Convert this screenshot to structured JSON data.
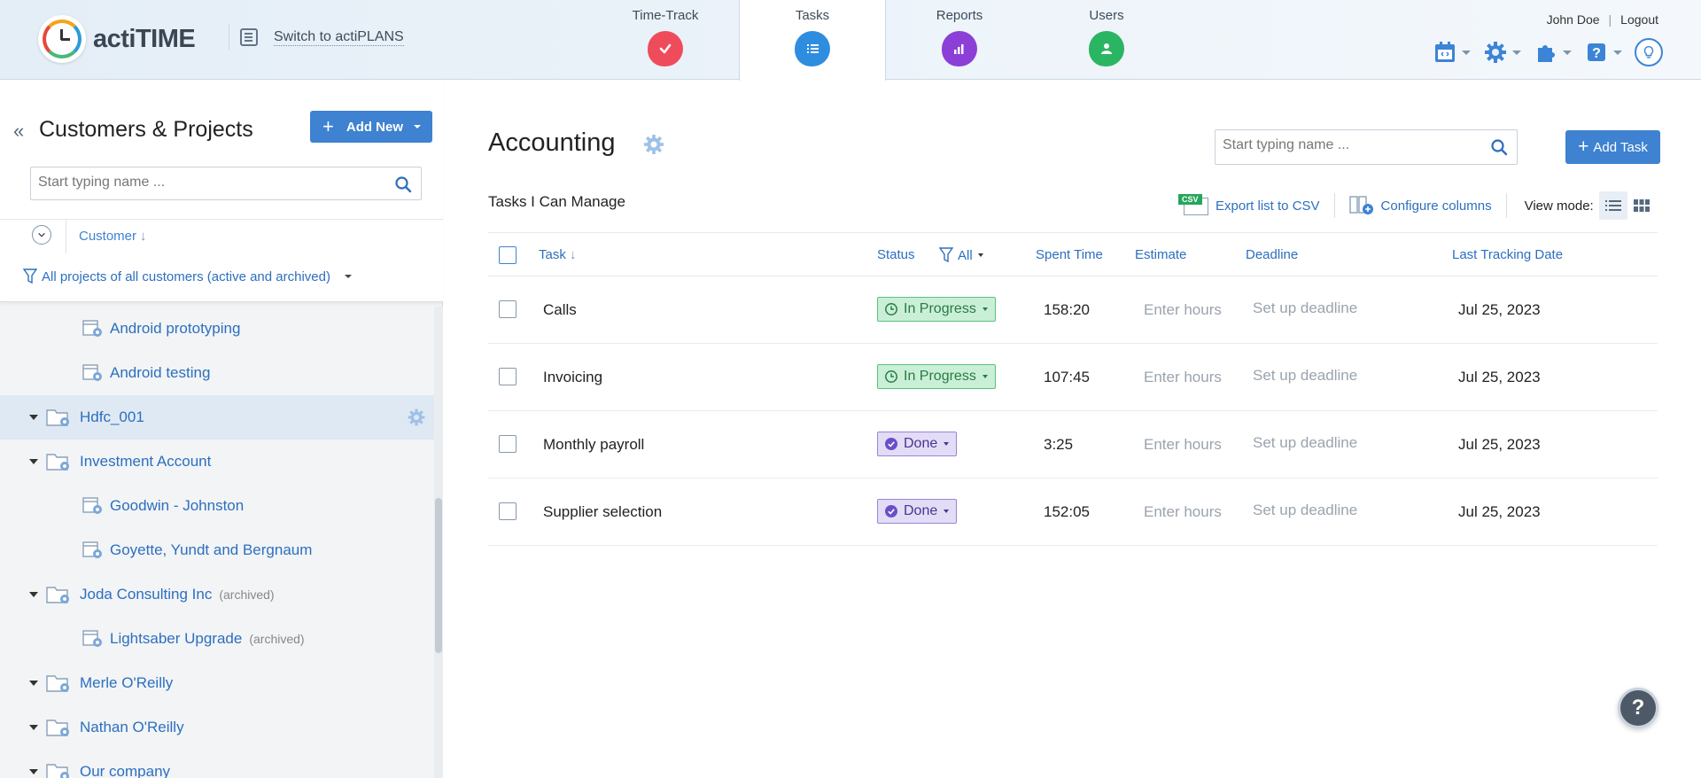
{
  "app": {
    "name": "actiTIME",
    "switch_label": "Switch to actiPLANS"
  },
  "nav": {
    "tabs": [
      {
        "label": "Time-Track",
        "icon": "check-icon",
        "active": false
      },
      {
        "label": "Tasks",
        "icon": "list-icon",
        "active": true
      },
      {
        "label": "Reports",
        "icon": "bar-chart-icon",
        "active": false
      },
      {
        "label": "Users",
        "icon": "user-icon",
        "active": false
      }
    ]
  },
  "user": {
    "name": "John Doe",
    "separator": "|",
    "logout_label": "Logout"
  },
  "sidebar": {
    "title": "Customers & Projects",
    "add_new_label": "Add New",
    "search_placeholder": "Start typing name ...",
    "sort_label": "Customer",
    "sort_arrow": "↓",
    "filter_label": "All projects of all customers (active and archived)",
    "tree": [
      {
        "type": "project",
        "label": "Android prototyping",
        "archived": ""
      },
      {
        "type": "project",
        "label": "Android testing",
        "archived": ""
      },
      {
        "type": "customer",
        "label": "Hdfc_001",
        "archived": "",
        "selected": true
      },
      {
        "type": "customer",
        "label": "Investment Account",
        "archived": ""
      },
      {
        "type": "project",
        "label": "Goodwin - Johnston",
        "archived": ""
      },
      {
        "type": "project",
        "label": "Goyette, Yundt and Bergnaum",
        "archived": ""
      },
      {
        "type": "customer",
        "label": "Joda Consulting Inc",
        "archived": "(archived)"
      },
      {
        "type": "project",
        "label": "Lightsaber Upgrade",
        "archived": "(archived)"
      },
      {
        "type": "customer",
        "label": "Merle O'Reilly",
        "archived": ""
      },
      {
        "type": "customer",
        "label": "Nathan O'Reilly",
        "archived": ""
      },
      {
        "type": "customer",
        "label": "Our company",
        "archived": ""
      }
    ]
  },
  "main": {
    "title": "Accounting",
    "search_placeholder": "Start typing name ...",
    "add_task_label": "Add Task",
    "subtitle": "Tasks I Can Manage",
    "export_tag": "CSV",
    "export_label": "Export list to CSV",
    "configure_label": "Configure columns",
    "view_mode_label": "View mode:",
    "columns": {
      "task": "Task",
      "task_arrow": "↓",
      "status": "Status",
      "status_filter": "All",
      "spent": "Spent Time",
      "estimate": "Estimate",
      "deadline": "Deadline",
      "last_tracking": "Last Tracking Date"
    },
    "rows": [
      {
        "task": "Calls",
        "status": "In Progress",
        "status_type": "inprog",
        "spent": "158:20",
        "estimate": "Enter hours",
        "deadline": "Set up deadline",
        "last_tracking": "Jul 25, 2023"
      },
      {
        "task": "Invoicing",
        "status": "In Progress",
        "status_type": "inprog",
        "spent": "107:45",
        "estimate": "Enter hours",
        "deadline": "Set up deadline",
        "last_tracking": "Jul 25, 2023"
      },
      {
        "task": "Monthly payroll",
        "status": "Done",
        "status_type": "done",
        "spent": "3:25",
        "estimate": "Enter hours",
        "deadline": "Set up deadline",
        "last_tracking": "Jul 25, 2023"
      },
      {
        "task": "Supplier selection",
        "status": "Done",
        "status_type": "done",
        "spent": "152:05",
        "estimate": "Enter hours",
        "deadline": "Set up deadline",
        "last_tracking": "Jul 25, 2023"
      }
    ]
  },
  "help_label": "?",
  "colors": {
    "accent": "#3e82d1",
    "link": "#2d6fbe",
    "in_progress_bg": "#c9f0d6",
    "done_bg": "#e3dcf6"
  }
}
